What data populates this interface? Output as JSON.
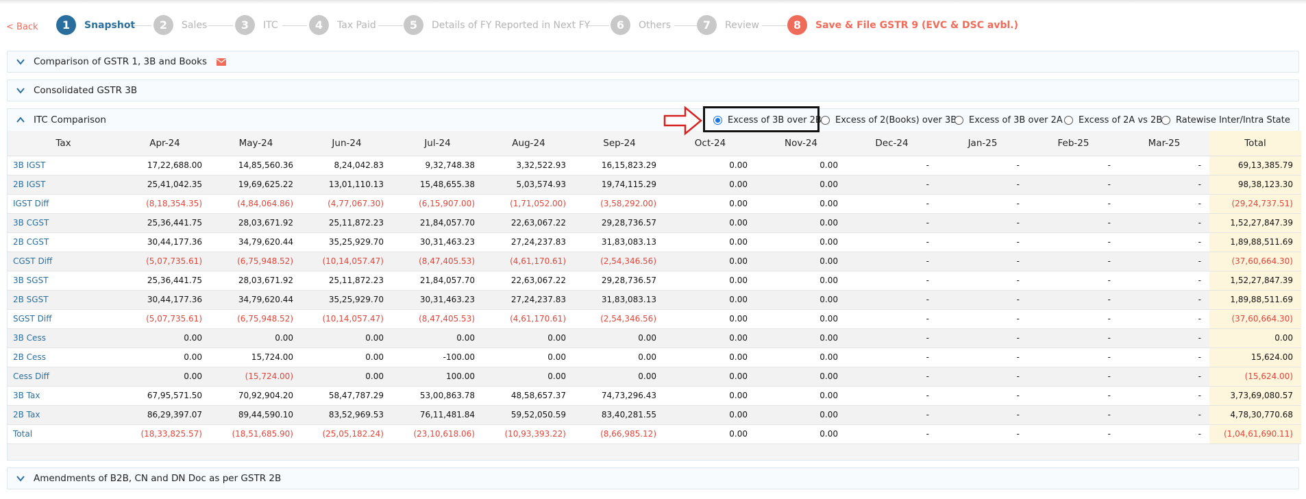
{
  "nav": {
    "back_label": "< Back",
    "steps": [
      {
        "number": "1",
        "label": "Snapshot",
        "state": "active"
      },
      {
        "number": "2",
        "label": "Sales",
        "state": "inactive"
      },
      {
        "number": "3",
        "label": "ITC",
        "state": "inactive"
      },
      {
        "number": "4",
        "label": "Tax Paid",
        "state": "inactive"
      },
      {
        "number": "5",
        "label": "Details of FY Reported in Next FY",
        "state": "inactive"
      },
      {
        "number": "6",
        "label": "Others",
        "state": "inactive"
      },
      {
        "number": "7",
        "label": "Review",
        "state": "inactive"
      },
      {
        "number": "8",
        "label": "Save & File GSTR 9 (EVC & DSC avbl.)",
        "state": "final"
      }
    ]
  },
  "panels": {
    "comparison": {
      "title": "Comparison of GSTR 1, 3B and Books",
      "icon": "mail-icon"
    },
    "consolidated": {
      "title": "Consolidated GSTR 3B"
    },
    "itc": {
      "title": "ITC Comparison"
    },
    "amendments": {
      "title": "Amendments of B2B, CN and DN Doc as per GSTR 2B"
    }
  },
  "radio_options": [
    {
      "label": "Excess of 3B over 2B",
      "checked": true
    },
    {
      "label": "Excess of 2(Books) over 3B",
      "checked": false
    },
    {
      "label": "Excess of 3B over 2A",
      "checked": false
    },
    {
      "label": "Excess of 2A vs 2B",
      "checked": false
    },
    {
      "label": "Ratewise Inter/Intra State",
      "checked": false
    }
  ],
  "table": {
    "columns": [
      "Tax",
      "Apr-24",
      "May-24",
      "Jun-24",
      "Jul-24",
      "Aug-24",
      "Sep-24",
      "Oct-24",
      "Nov-24",
      "Dec-24",
      "Jan-25",
      "Feb-25",
      "Mar-25",
      "Total"
    ],
    "rows": [
      {
        "label": "3B IGST",
        "values": [
          "17,22,688.00",
          "14,85,560.36",
          "8,24,042.83",
          "9,32,748.38",
          "3,32,522.93",
          "16,15,823.29",
          "0.00",
          "0.00",
          "-",
          "-",
          "-",
          "-",
          "69,13,385.79"
        ]
      },
      {
        "label": "2B IGST",
        "values": [
          "25,41,042.35",
          "19,69,625.22",
          "13,01,110.13",
          "15,48,655.38",
          "5,03,574.93",
          "19,74,115.29",
          "0.00",
          "0.00",
          "-",
          "-",
          "-",
          "-",
          "98,38,123.30"
        ]
      },
      {
        "label": "IGST Diff",
        "values": [
          "(8,18,354.35)",
          "(4,84,064.86)",
          "(4,77,067.30)",
          "(6,15,907.00)",
          "(1,71,052.00)",
          "(3,58,292.00)",
          "0.00",
          "0.00",
          "-",
          "-",
          "-",
          "-",
          "(29,24,737.51)"
        ]
      },
      {
        "label": "3B CGST",
        "values": [
          "25,36,441.75",
          "28,03,671.92",
          "25,11,872.23",
          "21,84,057.70",
          "22,63,067.22",
          "29,28,736.57",
          "0.00",
          "0.00",
          "-",
          "-",
          "-",
          "-",
          "1,52,27,847.39"
        ]
      },
      {
        "label": "2B CGST",
        "values": [
          "30,44,177.36",
          "34,79,620.44",
          "35,25,929.70",
          "30,31,463.23",
          "27,24,237.83",
          "31,83,083.13",
          "0.00",
          "0.00",
          "-",
          "-",
          "-",
          "-",
          "1,89,88,511.69"
        ]
      },
      {
        "label": "CGST Diff",
        "values": [
          "(5,07,735.61)",
          "(6,75,948.52)",
          "(10,14,057.47)",
          "(8,47,405.53)",
          "(4,61,170.61)",
          "(2,54,346.56)",
          "0.00",
          "0.00",
          "-",
          "-",
          "-",
          "-",
          "(37,60,664.30)"
        ]
      },
      {
        "label": "3B SGST",
        "values": [
          "25,36,441.75",
          "28,03,671.92",
          "25,11,872.23",
          "21,84,057.70",
          "22,63,067.22",
          "29,28,736.57",
          "0.00",
          "0.00",
          "-",
          "-",
          "-",
          "-",
          "1,52,27,847.39"
        ]
      },
      {
        "label": "2B SGST",
        "values": [
          "30,44,177.36",
          "34,79,620.44",
          "35,25,929.70",
          "30,31,463.23",
          "27,24,237.83",
          "31,83,083.13",
          "0.00",
          "0.00",
          "-",
          "-",
          "-",
          "-",
          "1,89,88,511.69"
        ]
      },
      {
        "label": "SGST Diff",
        "values": [
          "(5,07,735.61)",
          "(6,75,948.52)",
          "(10,14,057.47)",
          "(8,47,405.53)",
          "(4,61,170.61)",
          "(2,54,346.56)",
          "0.00",
          "0.00",
          "-",
          "-",
          "-",
          "-",
          "(37,60,664.30)"
        ]
      },
      {
        "label": "3B Cess",
        "values": [
          "0.00",
          "0.00",
          "0.00",
          "0.00",
          "0.00",
          "0.00",
          "0.00",
          "0.00",
          "-",
          "-",
          "-",
          "-",
          "0.00"
        ]
      },
      {
        "label": "2B Cess",
        "values": [
          "0.00",
          "15,724.00",
          "0.00",
          "-100.00",
          "0.00",
          "0.00",
          "0.00",
          "0.00",
          "-",
          "-",
          "-",
          "-",
          "15,624.00"
        ]
      },
      {
        "label": "Cess Diff",
        "values": [
          "0.00",
          "(15,724.00)",
          "0.00",
          "100.00",
          "0.00",
          "0.00",
          "0.00",
          "0.00",
          "-",
          "-",
          "-",
          "-",
          "(15,624.00)"
        ]
      },
      {
        "label": "3B Tax",
        "values": [
          "67,95,571.50",
          "70,92,904.20",
          "58,47,787.29",
          "53,00,863.78",
          "48,58,657.37",
          "74,73,296.43",
          "0.00",
          "0.00",
          "-",
          "-",
          "-",
          "-",
          "3,73,69,080.57"
        ]
      },
      {
        "label": "2B Tax",
        "values": [
          "86,29,397.07",
          "89,44,590.10",
          "83,52,969.53",
          "76,11,481.84",
          "59,52,050.59",
          "83,40,281.55",
          "0.00",
          "0.00",
          "-",
          "-",
          "-",
          "-",
          "4,78,30,770.68"
        ]
      },
      {
        "label": "Total",
        "values": [
          "(18,33,825.57)",
          "(18,51,685.90)",
          "(25,05,182.24)",
          "(23,10,618.06)",
          "(10,93,393.22)",
          "(8,66,985.12)",
          "0.00",
          "0.00",
          "-",
          "-",
          "-",
          "-",
          "(1,04,61,690.11)"
        ]
      }
    ]
  },
  "colors": {
    "active": "#2a6e9e",
    "accent": "#ef6c5a",
    "negative": "#e0463a",
    "total_column": "#fdf5dc"
  }
}
